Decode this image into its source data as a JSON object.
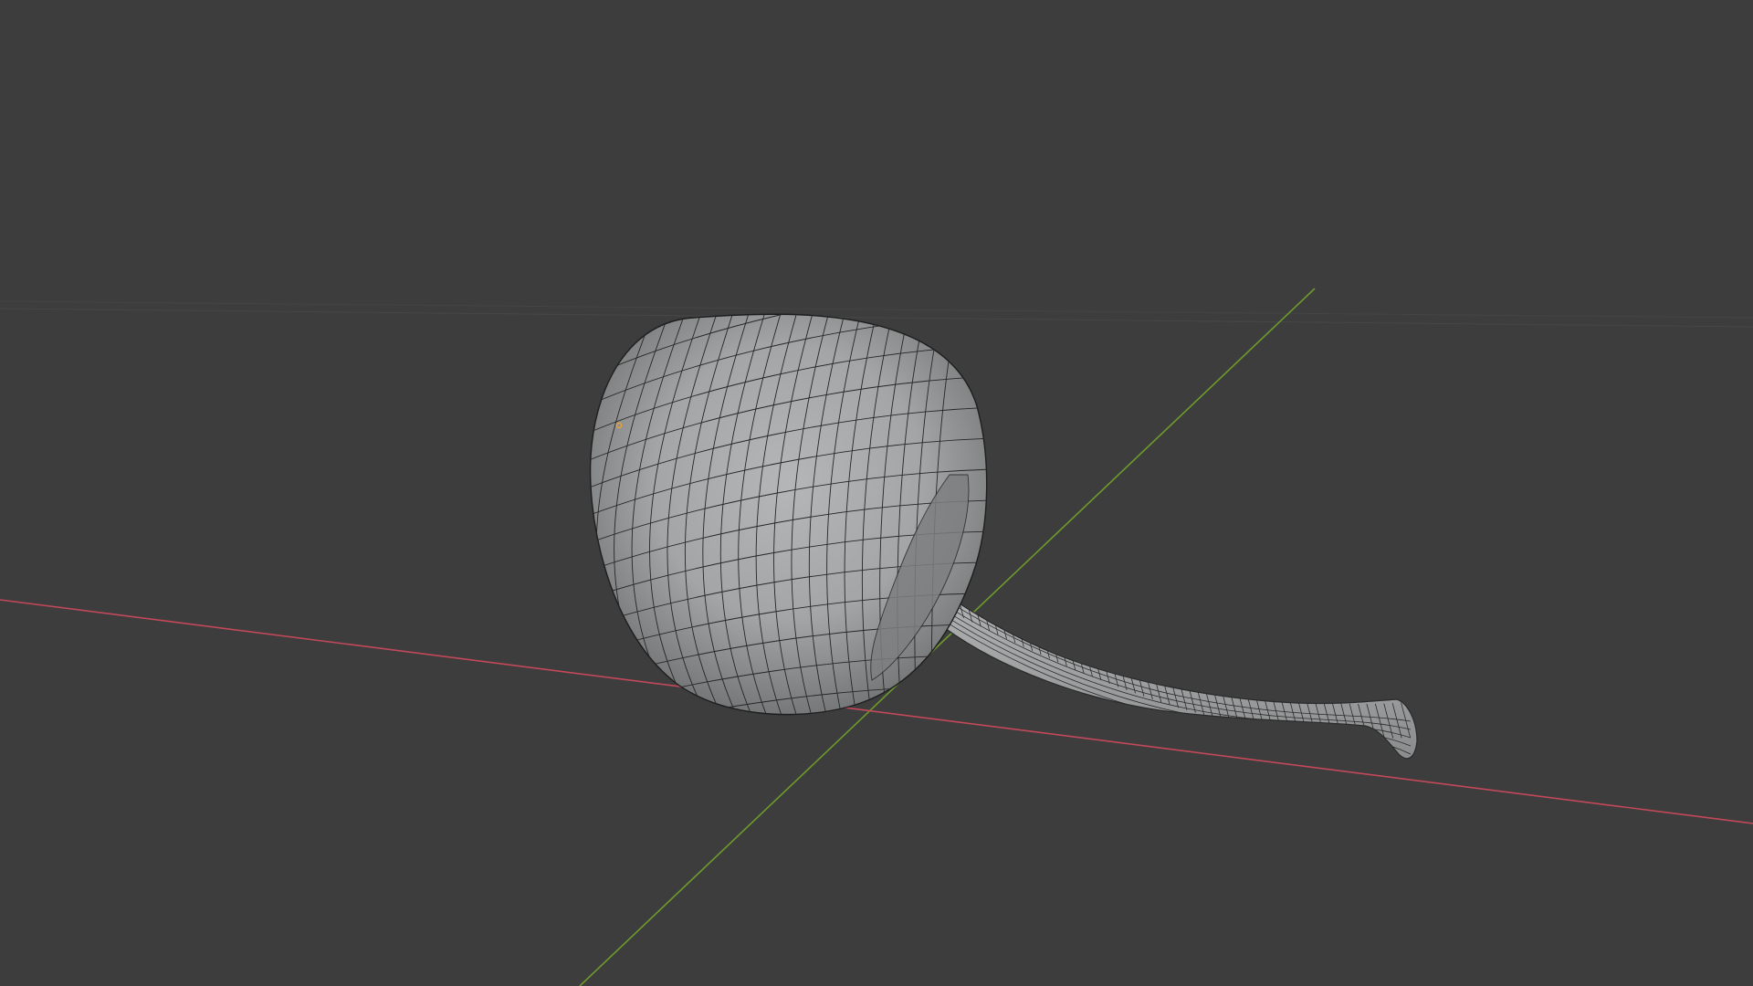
{
  "app": {
    "name": "3D viewport",
    "mode": "solid-wireframe"
  },
  "viewport": {
    "background_color": "#3d3d3d",
    "grid_color": "#474747",
    "x_axis_color": "#c3485a",
    "y_axis_color": "#6d9a2b",
    "mesh_fill_color": "#a9abac",
    "mesh_edge_color": "#202020",
    "origin_color": "#e8a33a"
  },
  "scene": {
    "objects": [
      {
        "name": "cherry-body",
        "shape": "rounded-sphere"
      },
      {
        "name": "cherry-stem",
        "shape": "tube"
      }
    ]
  }
}
